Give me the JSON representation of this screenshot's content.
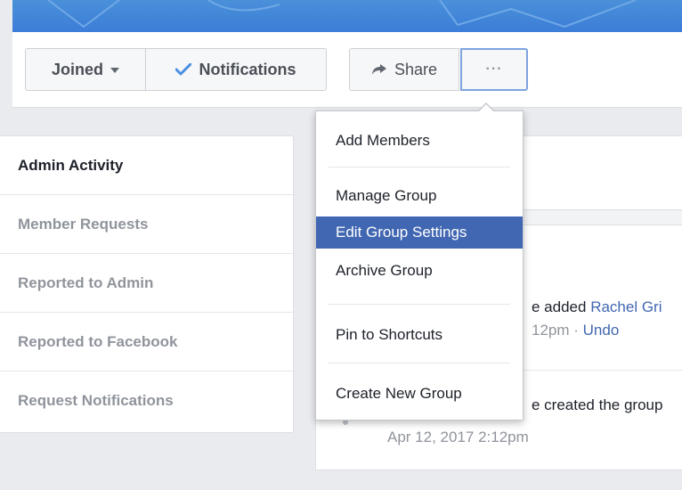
{
  "header": {
    "joined_label": "Joined",
    "notifications_label": "Notifications",
    "share_label": "Share",
    "more_label": "···"
  },
  "admin_nav": {
    "items": [
      {
        "label": "Admin Activity",
        "active": true
      },
      {
        "label": "Member Requests",
        "active": false
      },
      {
        "label": "Reported to Admin",
        "active": false
      },
      {
        "label": "Reported to Facebook",
        "active": false
      },
      {
        "label": "Request Notifications",
        "active": false
      }
    ]
  },
  "dropdown": {
    "items": [
      {
        "label": "Add Members",
        "highlighted": false
      },
      {
        "label": "Manage Group",
        "highlighted": false
      },
      {
        "label": "Edit Group Settings",
        "highlighted": true
      },
      {
        "label": "Archive Group",
        "highlighted": false
      },
      {
        "label": "Pin to Shortcuts",
        "highlighted": false
      },
      {
        "label": "Create New Group",
        "highlighted": false
      }
    ]
  },
  "activity": {
    "item1_text": "e added ",
    "item1_link": "Rachel Gri",
    "item1_time": "12pm · ",
    "item1_undo": "Undo",
    "item2_text": "e created the group",
    "item2_time": "Apr 12, 2017 2:12pm"
  },
  "colors": {
    "accent": "#4267b2",
    "check": "#4a90e2",
    "muted_text": "#90949c",
    "page_bg": "#e9ebee"
  },
  "icons": {
    "notifications": "check-icon",
    "share": "share-arrow-icon",
    "joined": "caret-down-icon"
  }
}
